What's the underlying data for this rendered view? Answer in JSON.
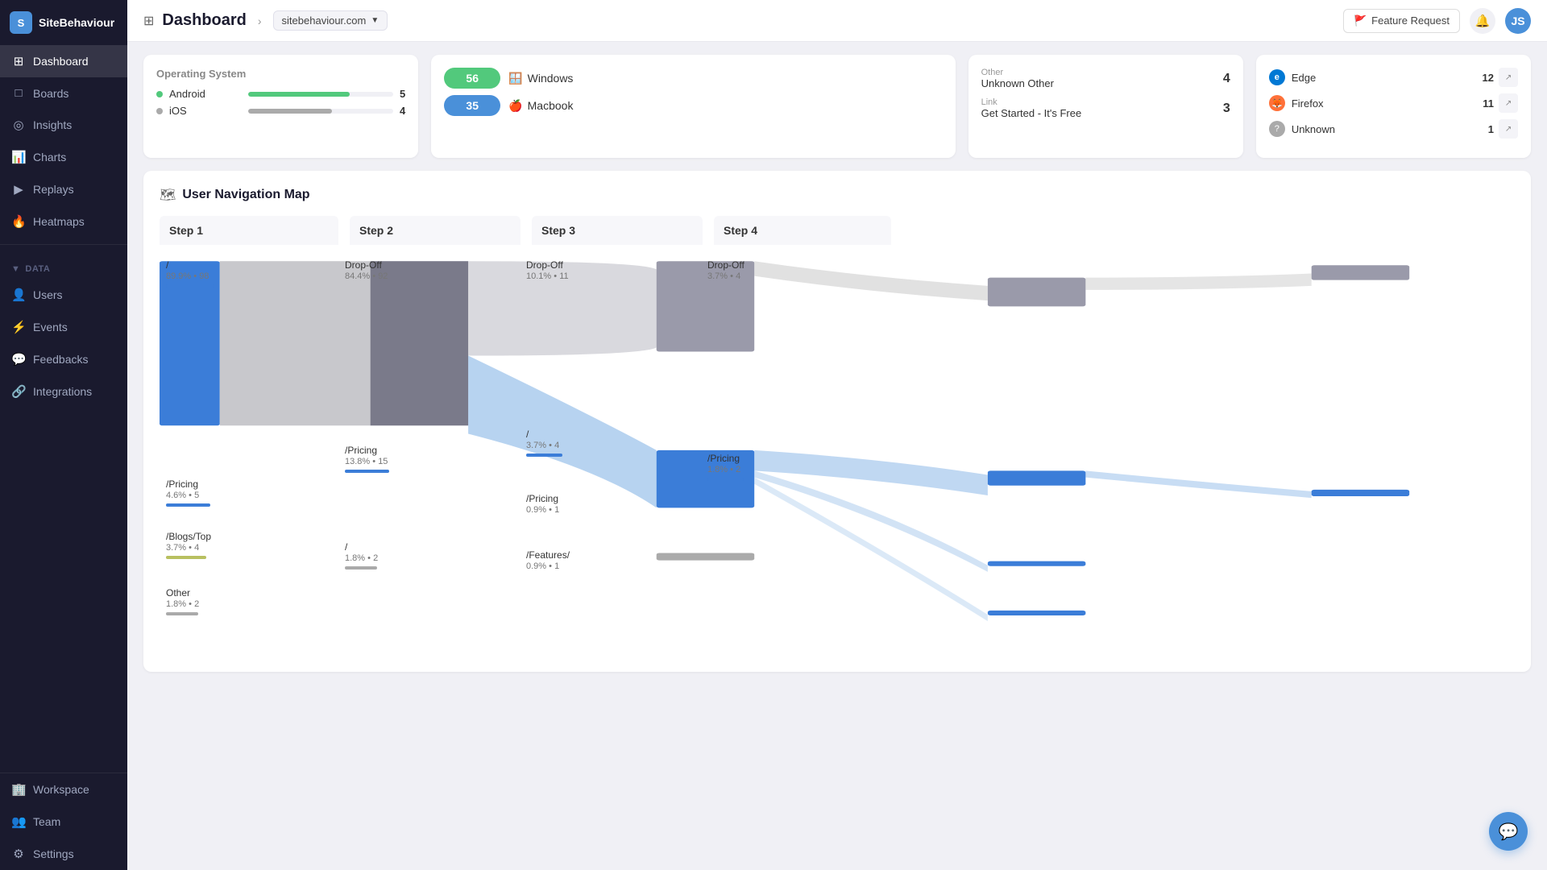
{
  "app": {
    "name": "SiteBehaviour",
    "logo_initial": "S"
  },
  "header": {
    "title": "Dashboard",
    "breadcrumb": "sitebehaviour.com",
    "feature_request": "Feature Request",
    "avatar_initial": "JS"
  },
  "sidebar": {
    "nav_items": [
      {
        "id": "dashboard",
        "label": "Dashboard",
        "icon": "⊞",
        "active": true
      },
      {
        "id": "boards",
        "label": "Boards",
        "icon": "□"
      },
      {
        "id": "insights",
        "label": "Insights",
        "icon": "◎"
      },
      {
        "id": "charts",
        "label": "Charts",
        "icon": "📊"
      },
      {
        "id": "replays",
        "label": "Replays",
        "icon": "▶"
      },
      {
        "id": "heatmaps",
        "label": "Heatmaps",
        "icon": "🔥"
      }
    ],
    "data_section": "Data",
    "data_items": [
      {
        "id": "users",
        "label": "Users",
        "icon": "👤"
      },
      {
        "id": "events",
        "label": "Events",
        "icon": "⚡"
      },
      {
        "id": "feedbacks",
        "label": "Feedbacks",
        "icon": "💬"
      },
      {
        "id": "integrations",
        "label": "Integrations",
        "icon": "🔗"
      }
    ],
    "bottom_items": [
      {
        "id": "workspace",
        "label": "Workspace",
        "icon": "🏢"
      },
      {
        "id": "team",
        "label": "Team",
        "icon": "👥"
      },
      {
        "id": "settings",
        "label": "Settings",
        "icon": "⚙"
      }
    ]
  },
  "os_panel": {
    "title": "Operating System",
    "items": [
      {
        "name": "Android",
        "count": 5,
        "color": "#52c97c",
        "percent": 56
      },
      {
        "name": "iOS",
        "count": 4,
        "color": "#888",
        "percent": 45
      }
    ]
  },
  "desktop_stats": {
    "items": [
      {
        "count": 56,
        "badge_class": "green",
        "os_icon": "🪟",
        "os_name": "Windows"
      },
      {
        "count": 35,
        "badge_class": "blue",
        "os_icon": "🍎",
        "os_name": "Macbook"
      }
    ]
  },
  "source_panel": {
    "items": [
      {
        "type": "Other",
        "name": "Unknown Other",
        "count": 4
      },
      {
        "type": "Link",
        "name": "Get Started - It's Free",
        "count": 3
      }
    ]
  },
  "browser_panel": {
    "items": [
      {
        "name": "Edge",
        "count": 12,
        "icon_color": "#0078d4",
        "icon_char": "e"
      },
      {
        "name": "Firefox",
        "count": 11,
        "icon_color": "#ff7139",
        "icon_char": "🦊"
      },
      {
        "name": "Unknown",
        "count": 1,
        "icon_color": "#aaa",
        "icon_char": "?"
      }
    ]
  },
  "nav_map": {
    "title": "User Navigation Map",
    "icon": "🗺",
    "steps": [
      "Step 1",
      "Step 2",
      "Step 3",
      "Step 4"
    ],
    "step1": {
      "nodes": [
        {
          "label": "/",
          "percent": "89.9%",
          "count": 98
        },
        {
          "label": "/Pricing",
          "percent": "4.6%",
          "count": 5
        },
        {
          "label": "/Blogs/Top",
          "percent": "3.7%",
          "count": 4
        },
        {
          "label": "Other",
          "percent": "1.8%",
          "count": 2
        }
      ]
    },
    "step2": {
      "nodes": [
        {
          "label": "Drop-Off",
          "percent": "84.4%",
          "count": 92
        },
        {
          "label": "/Pricing",
          "percent": "13.8%",
          "count": 15
        },
        {
          "label": "/",
          "percent": "1.8%",
          "count": 2
        }
      ]
    },
    "step3": {
      "nodes": [
        {
          "label": "Drop-Off",
          "percent": "10.1%",
          "count": 11
        },
        {
          "label": "/",
          "percent": "3.7%",
          "count": 4
        },
        {
          "label": "/Pricing",
          "percent": "0.9%",
          "count": 1
        },
        {
          "label": "/Features/",
          "percent": "0.9%",
          "count": 1
        }
      ]
    },
    "step4": {
      "nodes": [
        {
          "label": "Drop-Off",
          "percent": "3.7%",
          "count": 4
        },
        {
          "label": "/Pricing",
          "percent": "1.8%",
          "count": 2
        }
      ]
    }
  },
  "chat": {
    "icon": "💬"
  }
}
